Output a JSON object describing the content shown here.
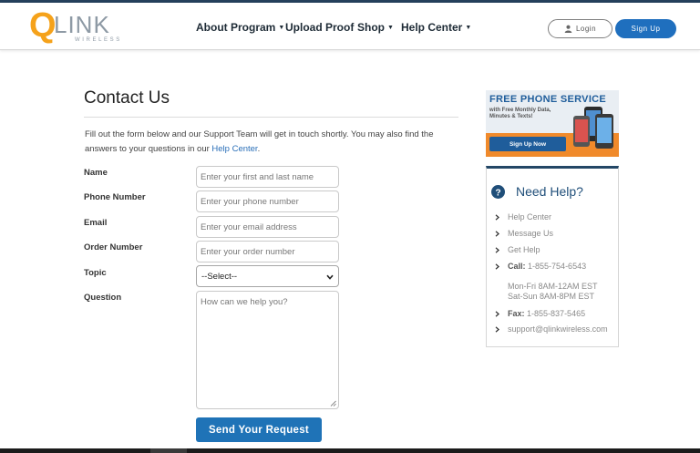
{
  "brand": {
    "logo_text": "QLINK",
    "logo_sub": "WIRELESS",
    "colors": {
      "primary": "#1f6fbe",
      "accent": "#f5a21b",
      "dark": "#25405c"
    }
  },
  "nav": {
    "items": [
      {
        "label": "About Program",
        "dropdown": true
      },
      {
        "label": "Upload Proof",
        "dropdown": false
      },
      {
        "label": "Shop",
        "dropdown": true
      },
      {
        "label": "Help Center",
        "dropdown": true
      }
    ],
    "login_label": "Login",
    "signup_label": "Sign Up"
  },
  "page": {
    "title": "Contact Us",
    "intro_line1": "Fill out the form below and our Support Team will get in touch shortly. You may also find the",
    "intro_line2_pre": "answers to your questions in our ",
    "intro_link": "Help Center",
    "intro_line2_post": "."
  },
  "form": {
    "name_label": "Name",
    "name_placeholder": "Enter your first and last name",
    "phone_label": "Phone Number",
    "phone_placeholder": "Enter your phone number",
    "email_label": "Email",
    "email_placeholder": "Enter your email address",
    "order_label": "Order Number",
    "order_placeholder": "Enter your order number",
    "topic_label": "Topic",
    "topic_selected": "--Select--",
    "question_label": "Question",
    "question_placeholder": "How can we help you?",
    "submit_label": "Send Your Request"
  },
  "promo": {
    "title": "FREE PHONE SERVICE",
    "subtitle": "with Free Monthly Data, Minutes & Texts!",
    "button": "Sign Up Now"
  },
  "help": {
    "heading": "Need Help?",
    "links": [
      "Help Center",
      "Message Us",
      "Get Help"
    ],
    "call_label": "Call:",
    "call_number": "1-855-754-6543",
    "hours_1": "Mon-Fri 8AM-12AM EST",
    "hours_2": "Sat-Sun 8AM-8PM EST",
    "fax_label": "Fax:",
    "fax_number": "1-855-837-5465",
    "email": "support@qlinkwireless.com"
  }
}
